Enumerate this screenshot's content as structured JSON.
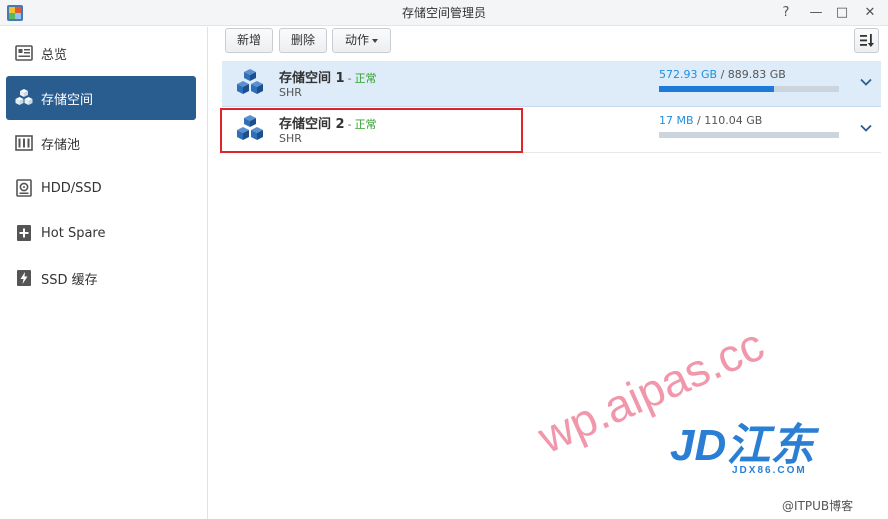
{
  "window": {
    "title": "存储空间管理员",
    "controls": {
      "help": "?",
      "minimize": "—",
      "maximize": "□",
      "close": "✕"
    }
  },
  "sidebar": {
    "items": [
      {
        "label": "总览",
        "icon": "overview-icon",
        "active": false
      },
      {
        "label": "存储空间",
        "icon": "volume-cubes-icon",
        "active": true
      },
      {
        "label": "存储池",
        "icon": "storage-pool-icon",
        "active": false
      },
      {
        "label": "HDD/SSD",
        "icon": "hdd-icon",
        "active": false
      },
      {
        "label": "Hot Spare",
        "icon": "hot-spare-plus-icon",
        "active": false
      },
      {
        "label": "SSD 缓存",
        "icon": "ssd-cache-icon",
        "active": false
      }
    ]
  },
  "toolbar": {
    "new_label": "新增",
    "delete_label": "删除",
    "action_label": "动作",
    "sort_icon": "sort-icon"
  },
  "volumes": [
    {
      "name": "存储空间 1",
      "dash": "-",
      "status": "正常",
      "type": "SHR",
      "used": "572.93 GB",
      "separator": "/",
      "total": "889.83 GB",
      "usage_fraction": 0.64,
      "selected": true
    },
    {
      "name": "存储空间 2",
      "dash": "-",
      "status": "正常",
      "type": "SHR",
      "used": "17 MB",
      "separator": "/",
      "total": "110.04 GB",
      "usage_fraction": 0.0,
      "selected": false
    }
  ],
  "watermarks": {
    "site": "wp.aipas.cc",
    "logo_text": "JD江东",
    "logo_sub": "JDX86.COM",
    "itpub": "@ITPUB博客"
  },
  "colors": {
    "active_nav": "#2a5d8f",
    "selected_row": "#deebf9",
    "usage_bar": "#1e7ad9",
    "status_ok": "#33a02c",
    "highlight": "#e0242a"
  }
}
